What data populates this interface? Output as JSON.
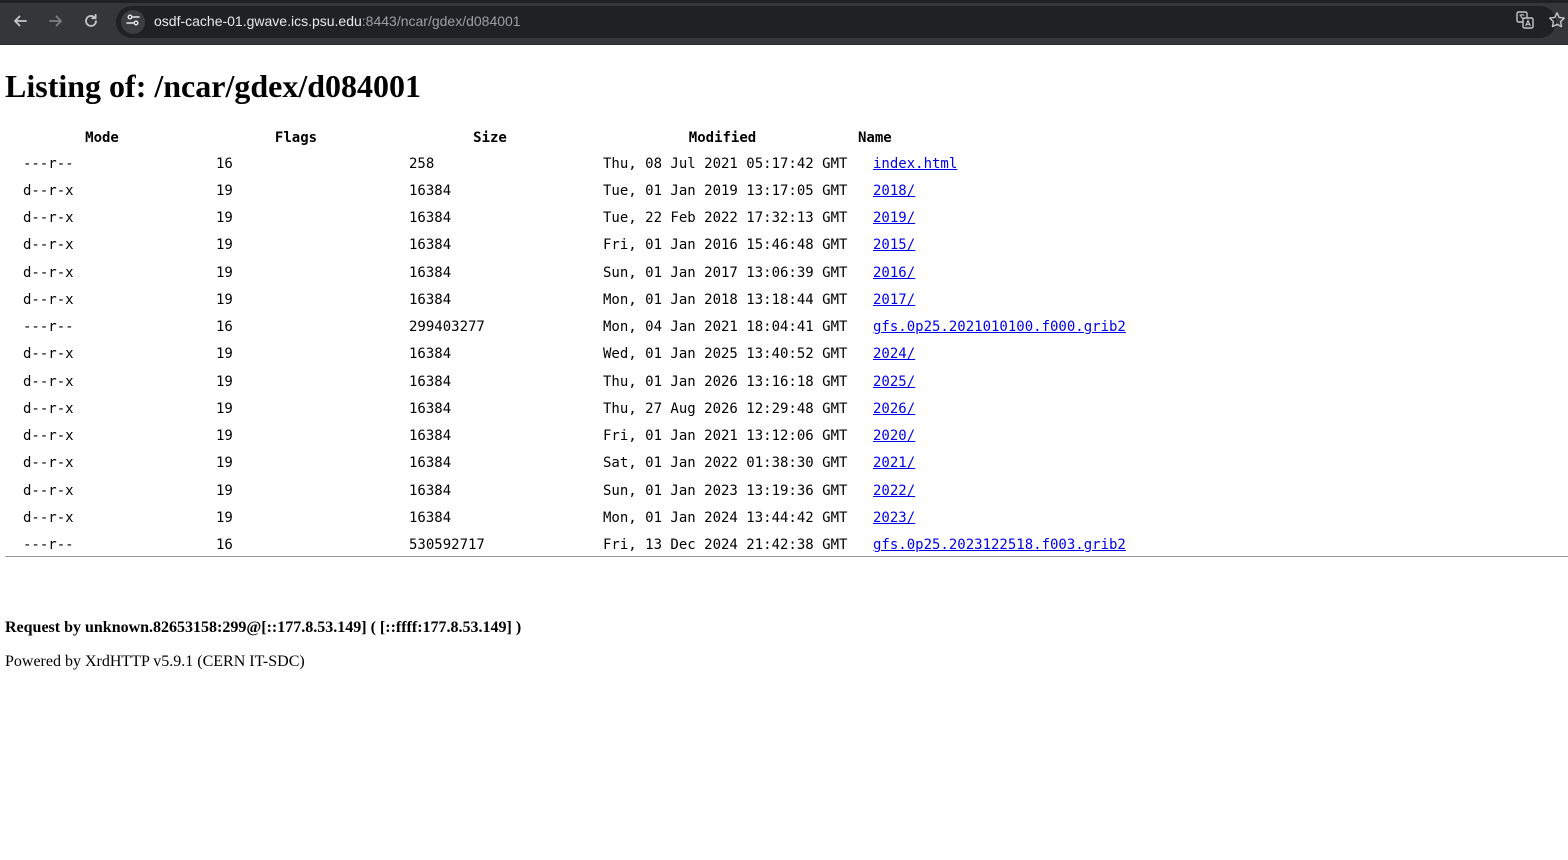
{
  "browser": {
    "url_host": "osdf-cache-01.gwave.ics.psu.edu",
    "url_path": ":8443/ncar/gdex/d084001",
    "icons": [
      "back-icon",
      "forward-icon",
      "reload-icon",
      "site-info-icon",
      "translate-icon",
      "bookmark-star-icon"
    ],
    "colors": {
      "toolbar": "#35363a",
      "omnibox": "#202124",
      "url_text": "#e8eaed",
      "link": "#0000ee"
    }
  },
  "page": {
    "title": "Listing of: /ncar/gdex/d084001",
    "columns": {
      "mode": "Mode",
      "flags": "Flags",
      "size": "Size",
      "modified": "Modified",
      "name": "Name"
    },
    "rows": [
      {
        "mode": "---r--",
        "flags": "16",
        "size": "258",
        "modified": "Thu, 08 Jul 2021 05:17:42 GMT",
        "name": "index.html"
      },
      {
        "mode": "d--r-x",
        "flags": "19",
        "size": "16384",
        "modified": "Tue, 01 Jan 2019 13:17:05 GMT",
        "name": "2018/"
      },
      {
        "mode": "d--r-x",
        "flags": "19",
        "size": "16384",
        "modified": "Tue, 22 Feb 2022 17:32:13 GMT",
        "name": "2019/"
      },
      {
        "mode": "d--r-x",
        "flags": "19",
        "size": "16384",
        "modified": "Fri, 01 Jan 2016 15:46:48 GMT",
        "name": "2015/"
      },
      {
        "mode": "d--r-x",
        "flags": "19",
        "size": "16384",
        "modified": "Sun, 01 Jan 2017 13:06:39 GMT",
        "name": "2016/"
      },
      {
        "mode": "d--r-x",
        "flags": "19",
        "size": "16384",
        "modified": "Mon, 01 Jan 2018 13:18:44 GMT",
        "name": "2017/"
      },
      {
        "mode": "---r--",
        "flags": "16",
        "size": "299403277",
        "modified": "Mon, 04 Jan 2021 18:04:41 GMT",
        "name": "gfs.0p25.2021010100.f000.grib2"
      },
      {
        "mode": "d--r-x",
        "flags": "19",
        "size": "16384",
        "modified": "Wed, 01 Jan 2025 13:40:52 GMT",
        "name": "2024/"
      },
      {
        "mode": "d--r-x",
        "flags": "19",
        "size": "16384",
        "modified": "Thu, 01 Jan 2026 13:16:18 GMT",
        "name": "2025/"
      },
      {
        "mode": "d--r-x",
        "flags": "19",
        "size": "16384",
        "modified": "Thu, 27 Aug 2026 12:29:48 GMT",
        "name": "2026/"
      },
      {
        "mode": "d--r-x",
        "flags": "19",
        "size": "16384",
        "modified": "Fri, 01 Jan 2021 13:12:06 GMT",
        "name": "2020/"
      },
      {
        "mode": "d--r-x",
        "flags": "19",
        "size": "16384",
        "modified": "Sat, 01 Jan 2022 01:38:30 GMT",
        "name": "2021/"
      },
      {
        "mode": "d--r-x",
        "flags": "19",
        "size": "16384",
        "modified": "Sun, 01 Jan 2023 13:19:36 GMT",
        "name": "2022/"
      },
      {
        "mode": "d--r-x",
        "flags": "19",
        "size": "16384",
        "modified": "Mon, 01 Jan 2024 13:44:42 GMT",
        "name": "2023/"
      },
      {
        "mode": "---r--",
        "flags": "16",
        "size": "530592717",
        "modified": "Fri, 13 Dec 2024 21:42:38 GMT",
        "name": "gfs.0p25.2023122518.f003.grib2"
      }
    ],
    "footer": {
      "request": "Request by unknown.82653158:299@[::177.8.53.149] ( [::ffff:177.8.53.149] )",
      "powered": "Powered by XrdHTTP v5.9.1 (CERN IT-SDC)"
    }
  }
}
